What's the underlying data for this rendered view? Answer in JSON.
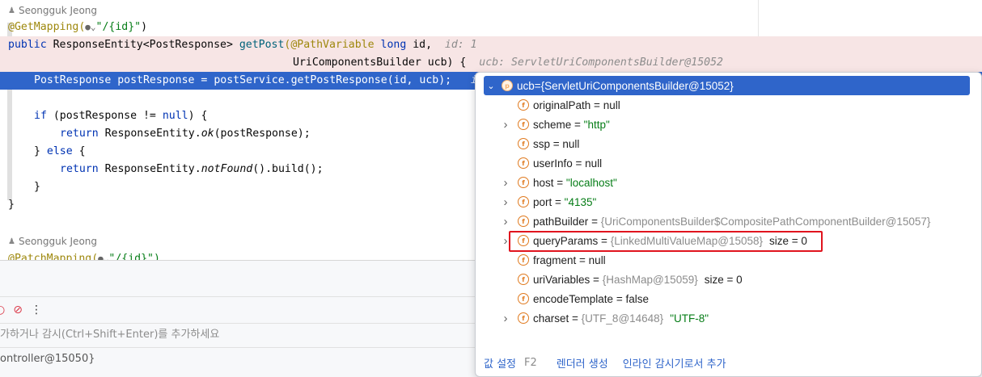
{
  "editor": {
    "author1": "Seongguk Jeong",
    "author2": "Seongguk Jeong",
    "lines": {
      "l1_annotation": "@GetMapping",
      "l1_path": "\"/{id}\"",
      "l1_close": ")",
      "l2_public": "public",
      "l2_type": " ResponseEntity<PostResponse> ",
      "l2_method": "getPost",
      "l2_params": "(@PathVariable ",
      "l2_long": "long",
      "l2_rest": " id,",
      "l2_inlay": "id: 1",
      "l3_params": "UriComponentsBuilder ucb) {",
      "l3_inlay": "ucb: ServletUriComponentsBuilder@15052",
      "l4_a": "PostResponse postResponse = ",
      "l4_field": "postService",
      "l4_b": ".getPostResponse(id, ucb);",
      "l4_inlay": "i",
      "l6_if": "if",
      "l6_a": " (postResponse != ",
      "l6_null": "null",
      "l6_b": ") {",
      "l7_return": "return",
      "l7_a": " ResponseEntity.",
      "l7_ok": "ok",
      "l7_b": "(postResponse);",
      "l8_a": "} ",
      "l8_else": "else",
      "l8_b": " {",
      "l9_return": "return",
      "l9_a": " ResponseEntity.",
      "l9_nf": "notFound",
      "l9_b": "().build();",
      "l10": "}",
      "l11": "}",
      "l14_annotation": "@PatchMapping",
      "l14_path": "\"/{id}\")"
    }
  },
  "debug_panel": {
    "watch_placeholder": "가하거나 감시(Ctrl+Shift+Enter)를 추가하세요",
    "frame_label": "ontroller@15050}"
  },
  "popup": {
    "root": {
      "name": "ucb",
      "eq": " = ",
      "value": "{ServletUriComponentsBuilder@15052}"
    },
    "fields": [
      {
        "name": "originalPath",
        "eq": " = ",
        "value": "null",
        "extra": ""
      },
      {
        "name": "scheme",
        "eq": " = ",
        "value": "\"http\"",
        "extra": ""
      },
      {
        "name": "ssp",
        "eq": " = ",
        "value": "null",
        "extra": ""
      },
      {
        "name": "userInfo",
        "eq": " = ",
        "value": "null",
        "extra": ""
      },
      {
        "name": "host",
        "eq": " = ",
        "value": "\"localhost\"",
        "extra": ""
      },
      {
        "name": "port",
        "eq": " = ",
        "value": "\"4135\"",
        "extra": ""
      },
      {
        "name": "pathBuilder",
        "eq": " = ",
        "value": "{UriComponentsBuilder$CompositePathComponentBuilder@15057}",
        "extra": ""
      },
      {
        "name": "queryParams",
        "eq": " = ",
        "value": "{LinkedMultiValueMap@15058}",
        "extra": "size = 0"
      },
      {
        "name": "fragment",
        "eq": " = ",
        "value": "null",
        "extra": ""
      },
      {
        "name": "uriVariables",
        "eq": " = ",
        "value": "{HashMap@15059}",
        "extra": "size = 0"
      },
      {
        "name": "encodeTemplate",
        "eq": " = ",
        "value": "false",
        "extra": ""
      },
      {
        "name": "charset",
        "eq": " = ",
        "value": "{UTF_8@14648}",
        "extra": "\"UTF-8\""
      }
    ],
    "footer": {
      "set_value": "값 설정",
      "set_value_key": "F2",
      "create_renderer": "렌더러 생성",
      "add_inline_watch": "인라인 감시기로서 추가"
    }
  },
  "colors": {
    "accent": "#2f65ca",
    "highlight_box": "#e0141e",
    "breakpoint_line": "#f7e5e5"
  },
  "icons": [
    "person-icon",
    "globe-icon",
    "field-icon",
    "parameter-icon",
    "chevron-down-icon",
    "chevron-right-icon",
    "breakpoint-icon",
    "mute-breakpoints-icon",
    "more-icon"
  ]
}
